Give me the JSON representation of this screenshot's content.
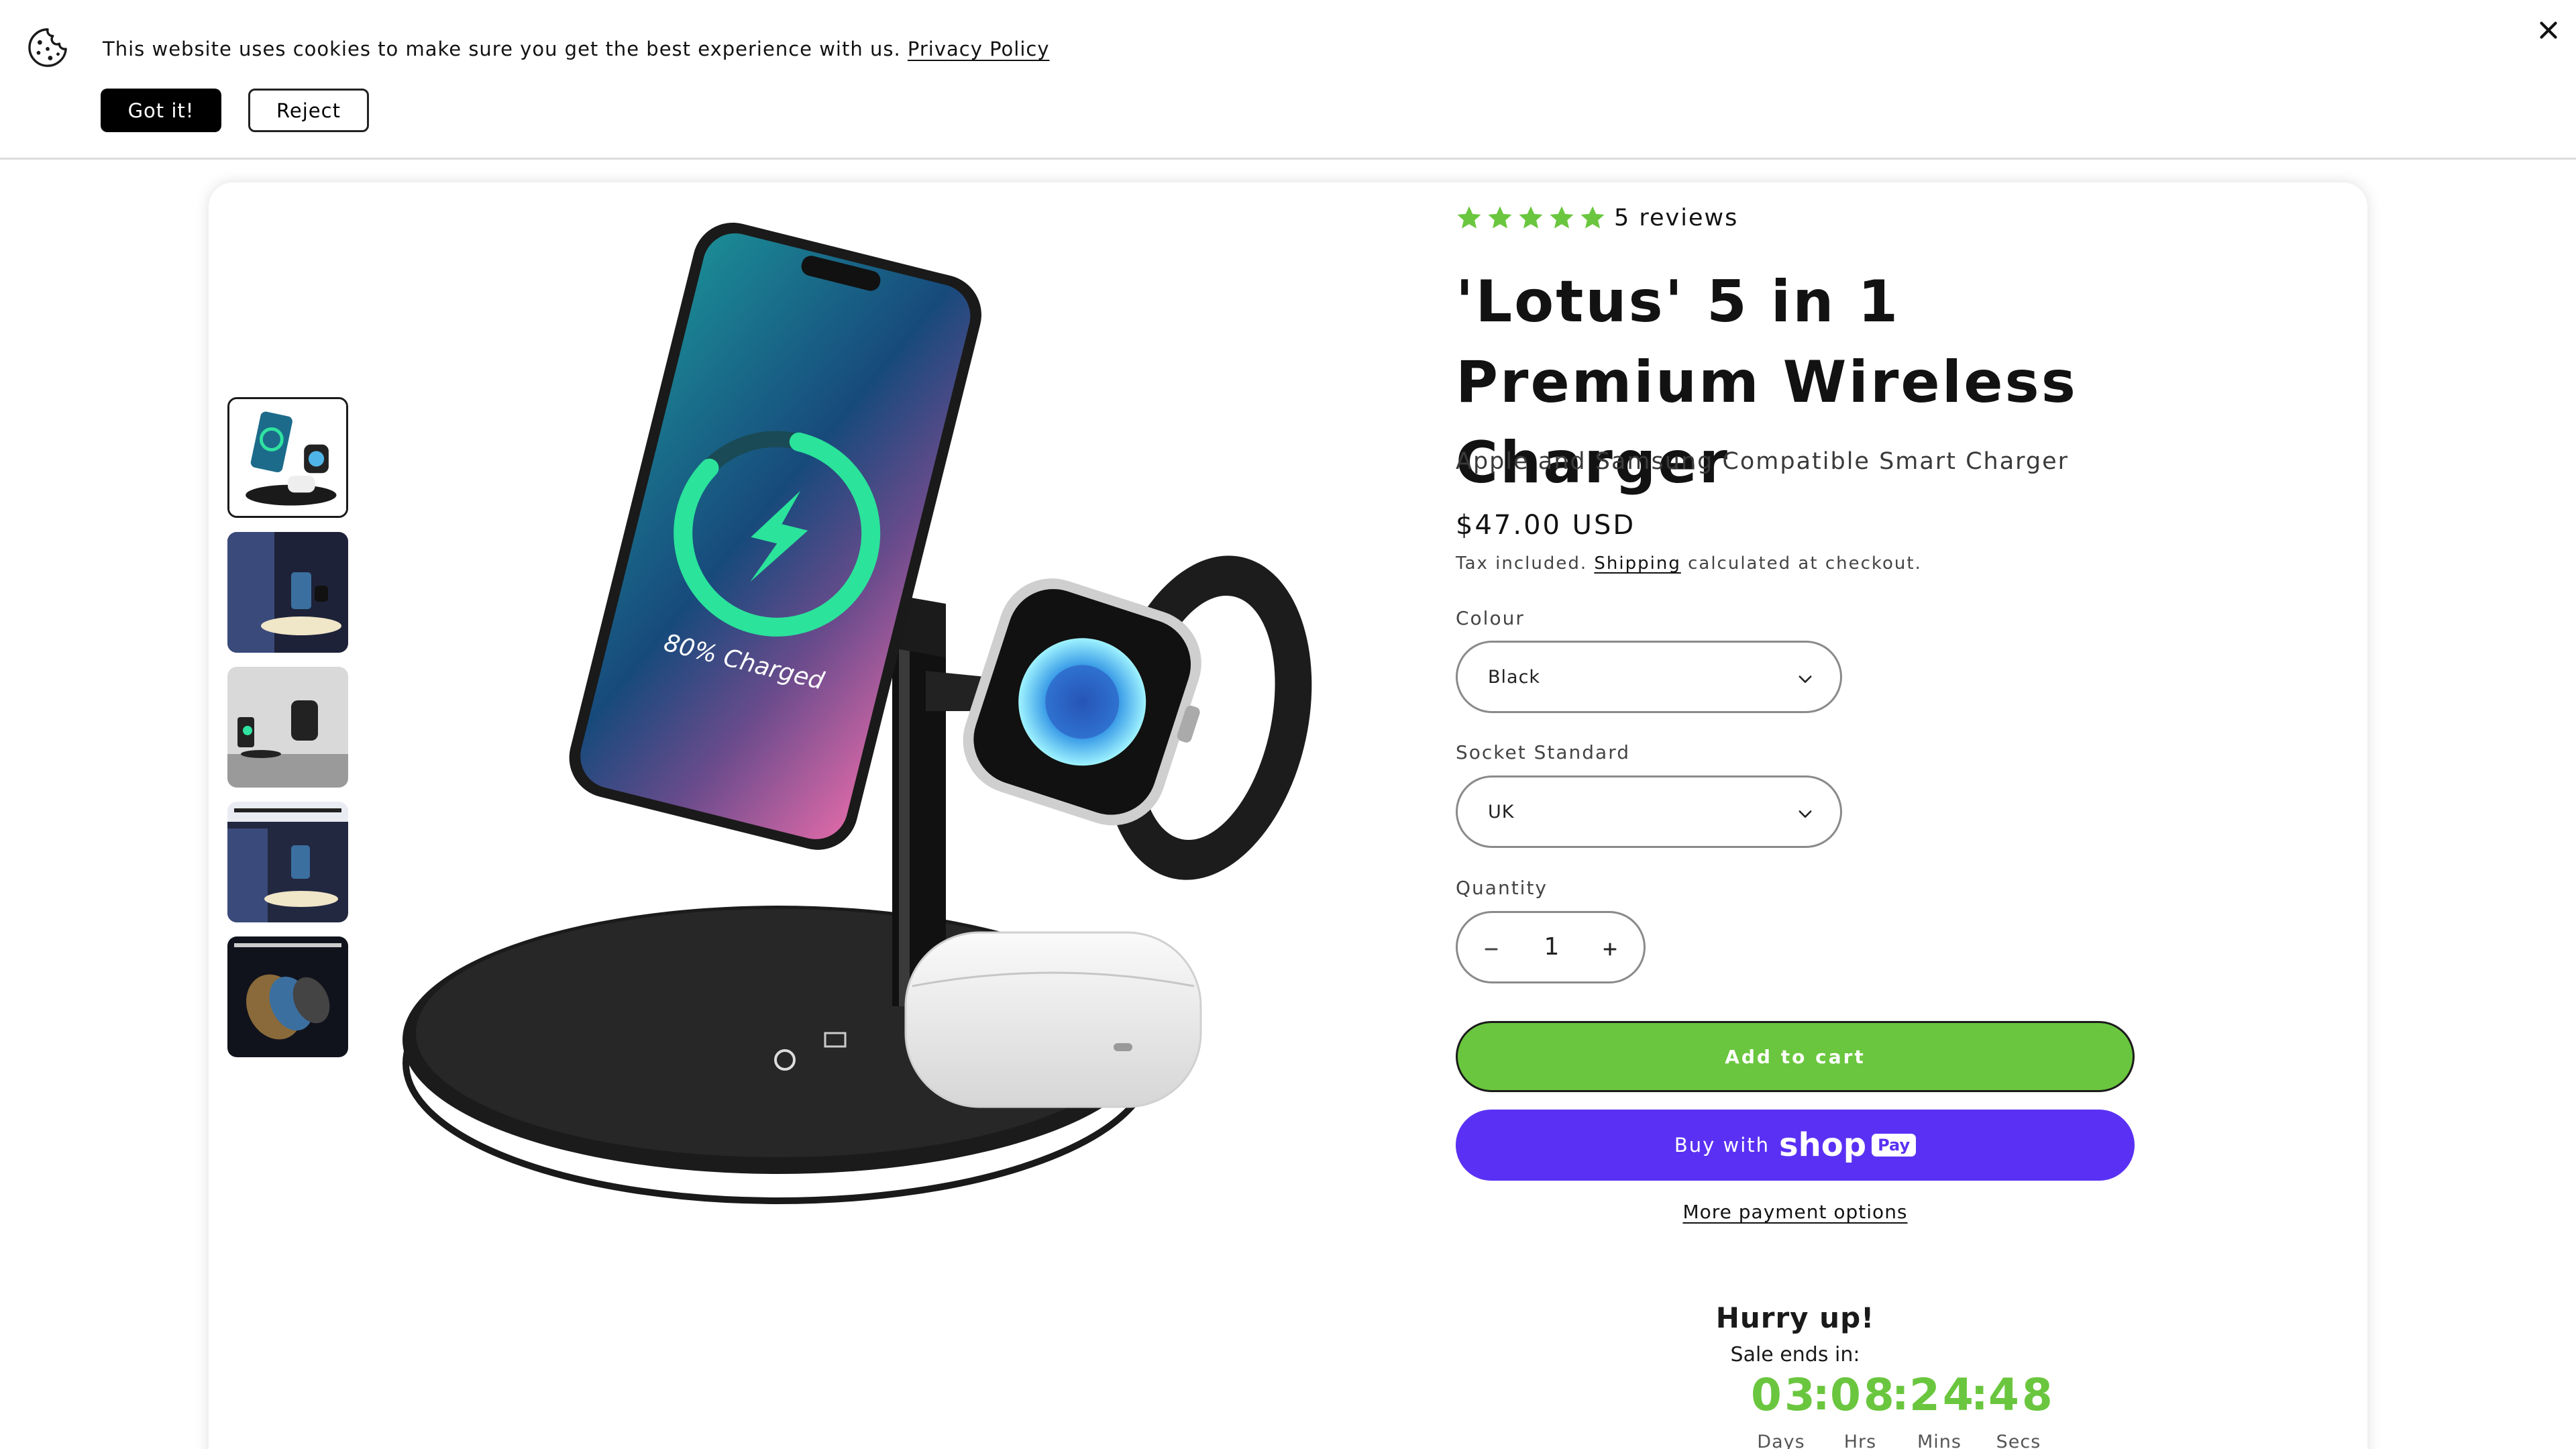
{
  "cookie_banner": {
    "message": "This website uses cookies to make sure you get the best experience with us.",
    "privacy_link": "Privacy Policy",
    "accept_label": "Got it!",
    "reject_label": "Reject"
  },
  "product": {
    "rating": {
      "stars": 5,
      "reviews_label": "5 reviews",
      "star_color": "#6ac63e"
    },
    "title": "'Lotus' 5 in 1 Premium Wireless Charger",
    "subtitle": "Apple and Samsung Compatible Smart Charger",
    "price": "$47.00 USD",
    "tax_prefix": "Tax included.",
    "shipping_link": "Shipping",
    "tax_suffix": "calculated at checkout.",
    "phone_screen_text": "80% Charged",
    "thumbnail_count": 5,
    "options": {
      "colour_label": "Colour",
      "colour_value": "Black",
      "socket_label": "Socket Standard",
      "socket_value": "UK",
      "quantity_label": "Quantity",
      "quantity_value": "1"
    },
    "add_to_cart_label": "Add to cart",
    "shop_pay": {
      "buy_with": "Buy with",
      "shop": "shop",
      "pay": "Pay"
    },
    "more_payment_label": "More payment options",
    "countdown": {
      "heading": "Hurry up!",
      "subheading": "Sale ends in:",
      "days": "03",
      "hours": "08",
      "minutes": "24",
      "seconds": "48",
      "days_label": "Days",
      "hours_label": "Hrs",
      "minutes_label": "Mins",
      "seconds_label": "Secs"
    }
  },
  "colors": {
    "accent_green": "#6ac63e",
    "shop_pay_purple": "#5a31f4",
    "text_dark": "#121212"
  }
}
